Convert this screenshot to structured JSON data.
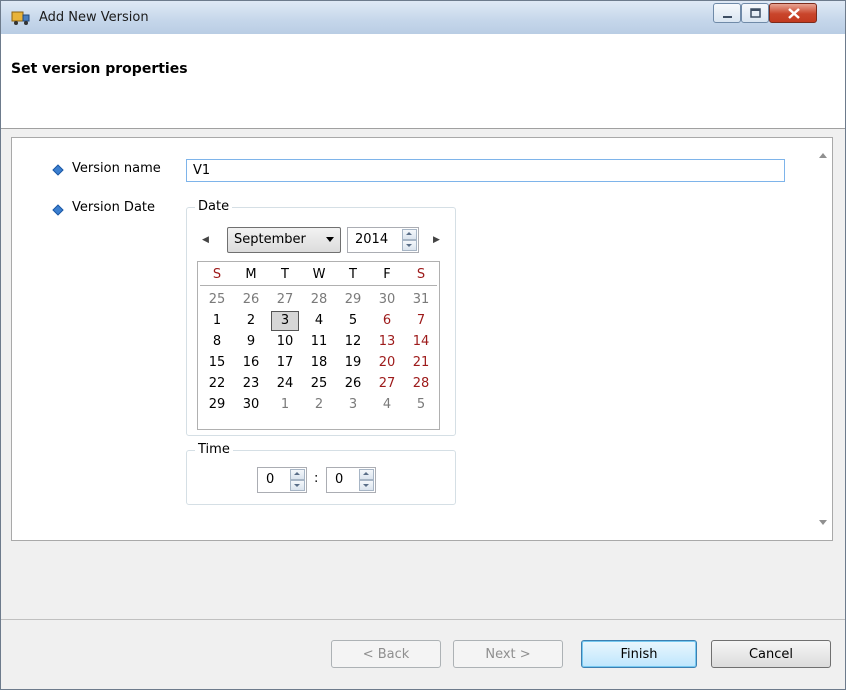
{
  "window": {
    "title": "Add New Version"
  },
  "header": {
    "title": "Set version properties"
  },
  "form": {
    "version_name_label": "Version name",
    "version_name_value": "V1",
    "version_date_label": "Version Date"
  },
  "date_group": {
    "legend": "Date",
    "month": "September",
    "year": "2014",
    "days_of_week": [
      "S",
      "M",
      "T",
      "W",
      "T",
      "F",
      "S"
    ],
    "weeks": [
      [
        "25",
        "26",
        "27",
        "28",
        "29",
        "30",
        "31"
      ],
      [
        "1",
        "2",
        "3",
        "4",
        "5",
        "6",
        "7"
      ],
      [
        "8",
        "9",
        "10",
        "11",
        "12",
        "13",
        "14"
      ],
      [
        "15",
        "16",
        "17",
        "18",
        "19",
        "20",
        "21"
      ],
      [
        "22",
        "23",
        "24",
        "25",
        "26",
        "27",
        "28"
      ],
      [
        "29",
        "30",
        "1",
        "2",
        "3",
        "4",
        "5"
      ]
    ],
    "selected_day": "3"
  },
  "time_group": {
    "legend": "Time",
    "hour": "0",
    "separator": ":",
    "minute": "0"
  },
  "buttons": {
    "back": "< Back",
    "next": "Next >",
    "finish": "Finish",
    "cancel": "Cancel"
  },
  "colors": {
    "weekend": "#9d1a1a",
    "muted": "#7a7a7a",
    "accent": "#3b7fd0"
  }
}
